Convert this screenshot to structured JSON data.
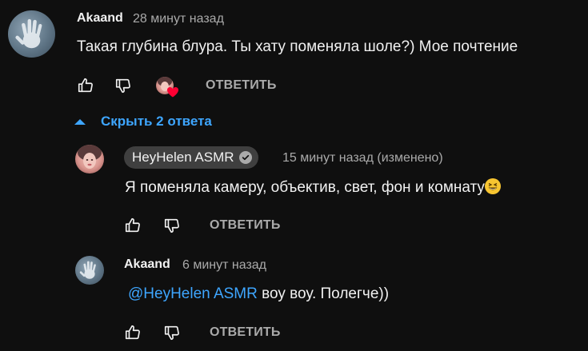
{
  "comment1": {
    "author": "Akaand",
    "time": "28 минут назад",
    "text": "Такая глубина блура. Ты хату поменяла шоле?) Мое почтение",
    "reply_label": "ОТВЕТИТЬ"
  },
  "replies_toggle": {
    "label": "Скрыть 2 ответа"
  },
  "reply1": {
    "author": "HeyHelen ASMR",
    "time": "15 минут назад (изменено)",
    "text": "Я поменяла камеру, объектив, свет, фон и комнату",
    "reply_label": "ОТВЕТИТЬ"
  },
  "reply2": {
    "author": "Akaand",
    "time": "6 минут назад",
    "mention": "@HeyHelen ASMR",
    "text": " воу воу. Полегче))",
    "reply_label": "ОТВЕТИТЬ"
  },
  "colors": {
    "background": "#0f0f0f",
    "accent": "#3ea6ff",
    "heart": "#ff0033",
    "muted": "#aaaaaa"
  }
}
